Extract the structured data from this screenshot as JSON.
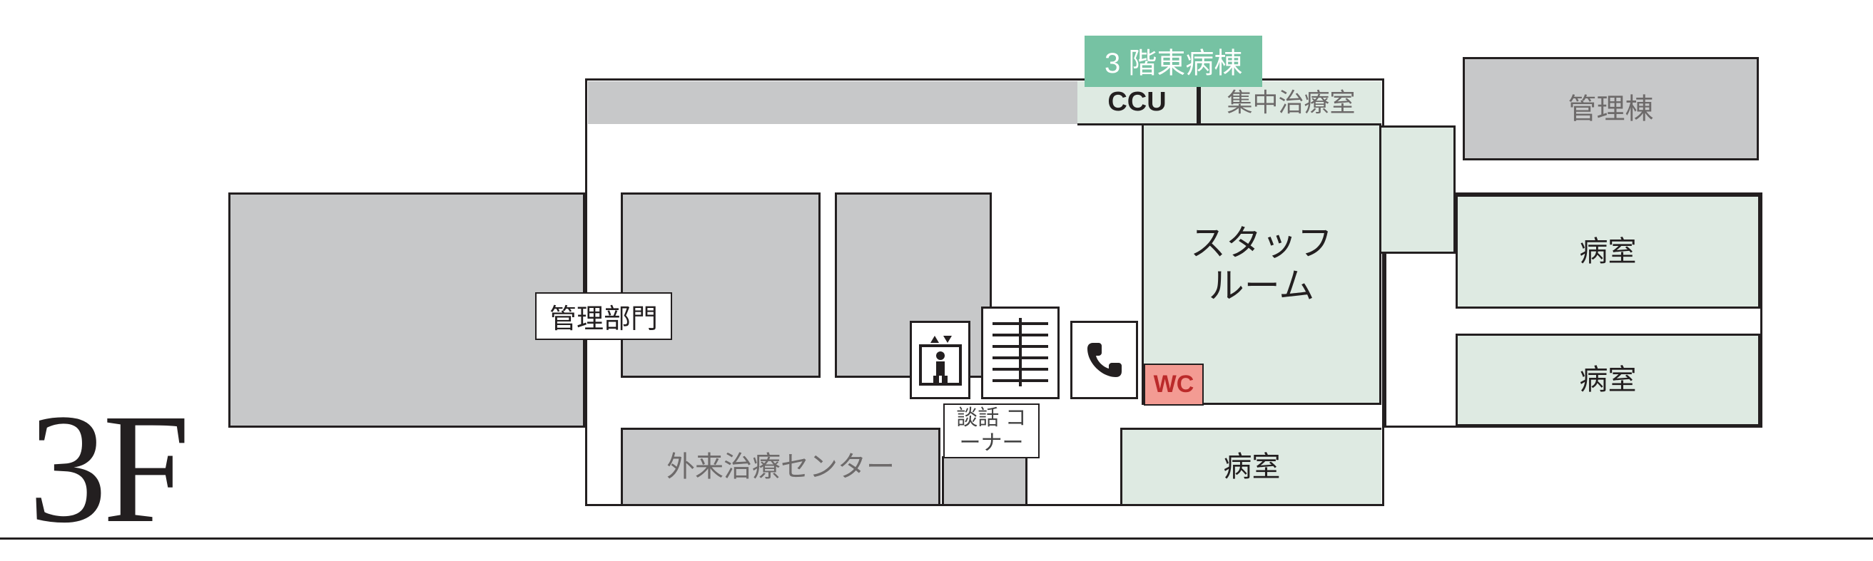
{
  "floor_label": "3F",
  "ward_badge": "3 階東病棟",
  "rooms": {
    "kanri_bumon": "管理部門",
    "kanri_to": "管理棟",
    "gairai_center": "外来治療センター",
    "ccu": "CCU",
    "shuchu_chiryo": "集中治療室",
    "staff_room": "スタッフ\nルーム",
    "byoshitsu": "病室",
    "danwa": "談話\nコーナー",
    "wc": "WC"
  }
}
